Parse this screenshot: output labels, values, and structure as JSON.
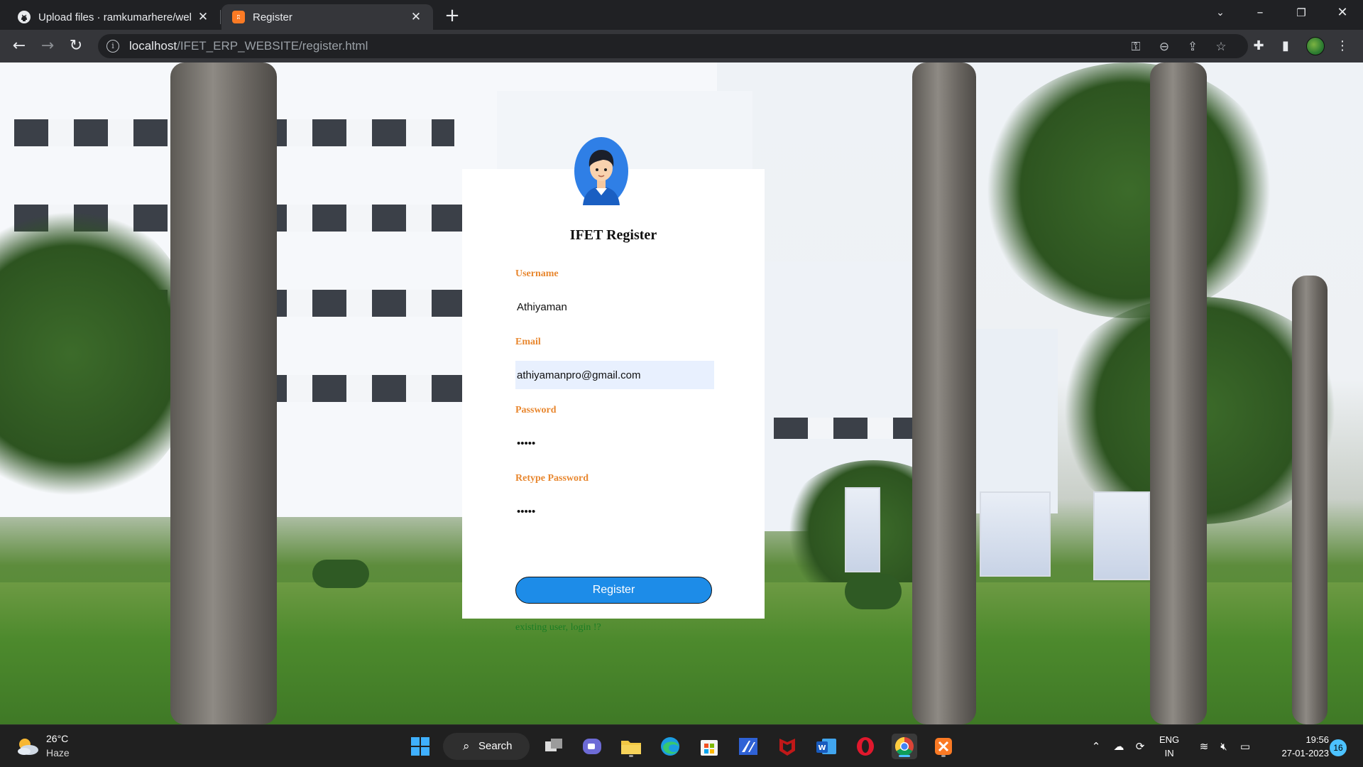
{
  "browser": {
    "tabs": [
      {
        "title": "Upload files · ramkumarhere/wel",
        "icon": "github-icon",
        "active": false
      },
      {
        "title": "Register",
        "icon": "xampp-icon",
        "active": true
      }
    ],
    "url_host": "localhost",
    "url_path": "/IFET_ERP_WEBSITE/register.html"
  },
  "form": {
    "title": "IFET Register",
    "username_label": "Username",
    "username_value": "Athiyaman",
    "email_label": "Email",
    "email_value": "athiyamanpro@gmail.com",
    "password_label": "Password",
    "password_value": "•••••",
    "retype_label": "Retype Password",
    "retype_value": "•••••",
    "submit_label": "Register",
    "login_link": "existing user, login !?"
  },
  "taskbar": {
    "weather_temp": "26°C",
    "weather_desc": "Haze",
    "search_label": "Search",
    "apps": [
      "start-icon",
      "task-view-icon",
      "teams-chat-icon",
      "file-explorer-icon",
      "edge-icon",
      "microsoft-store-icon",
      "visual-studio-icon",
      "mcafee-icon",
      "word-icon",
      "opera-icon",
      "chrome-icon",
      "xampp-icon"
    ],
    "lang_top": "ENG",
    "lang_bottom": "IN",
    "time": "19:56",
    "date": "27-01-2023",
    "notification_count": "16"
  },
  "colors": {
    "label": "#e8872f",
    "button": "#1d8ce8",
    "link": "#1c7d24",
    "autofill": "#e8f0fe"
  }
}
